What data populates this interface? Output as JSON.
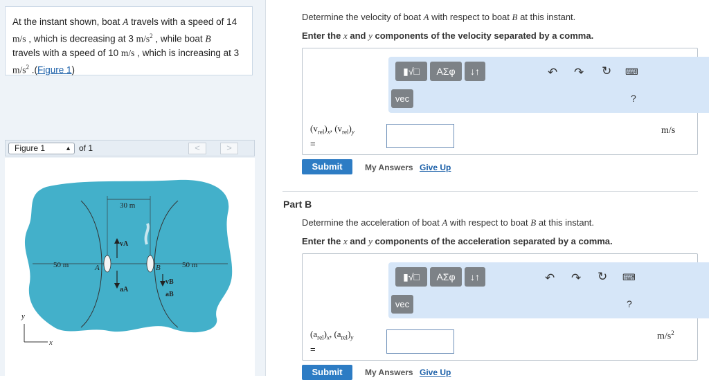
{
  "problem": {
    "text_1": "At the instant shown, boat ",
    "boat_a": "A",
    "text_2": " travels with a speed of 14",
    "unit_ms": "m/s",
    "text_3": " , which is decreasing at 3 ",
    "unit_ms2_base": "m/s",
    "unit_sup": "2",
    "text_4": " , while boat ",
    "boat_b": "B",
    "text_5": "travels with a speed of 10 ",
    "text_6": " , which is increasing at 3",
    "text_7": " .(",
    "figure_link": "Figure 1",
    "text_8": ")"
  },
  "figure_nav": {
    "selected": "Figure 1",
    "of_text": "of 1",
    "prev": "<",
    "next": ">"
  },
  "figure": {
    "dim_top": "30 m",
    "dim_left": "50 m",
    "dim_right": "50 m",
    "label_a": "A",
    "label_b": "B",
    "label_va": "vA",
    "label_aa": "aA",
    "label_vb": "vB",
    "label_ab": "aB",
    "axis_y": "y",
    "axis_x": "x",
    "water_color": "#2fa7c4"
  },
  "partA": {
    "question_1": "Determine the velocity of boat ",
    "question_a": "A",
    "question_2": " with respect to boat ",
    "question_b": "B",
    "question_3": " at this instant.",
    "instr_1": "Enter the ",
    "instr_x": "x",
    "instr_2": " and ",
    "instr_y": "y",
    "instr_3": " components of the velocity separated by a comma.",
    "label_main": "(v",
    "label_sub": "rel",
    "label_x": "x",
    "label_y": "y",
    "equals": "=",
    "unit": "m/s",
    "submit": "Submit",
    "my_answers": "My Answers",
    "give_up": "Give Up"
  },
  "partB": {
    "title": "Part B",
    "question_1": "Determine the acceleration of boat ",
    "question_a": "A",
    "question_2": " with respect to boat ",
    "question_b": "B",
    "question_3": " at this instant.",
    "instr_1": "Enter the ",
    "instr_x": "x",
    "instr_2": " and ",
    "instr_y": "y",
    "instr_3": " components of the acceleration separated by a comma.",
    "label_main": "(a",
    "label_sub": "rel",
    "label_x": "x",
    "label_y": "y",
    "equals": "=",
    "unit_base": "m/s",
    "unit_sup": "2",
    "submit": "Submit",
    "my_answers": "My Answers",
    "give_up": "Give Up"
  },
  "toolbar": {
    "greek": "ΑΣφ",
    "arrows": "↓↑",
    "vec": "vec",
    "help": "?"
  }
}
